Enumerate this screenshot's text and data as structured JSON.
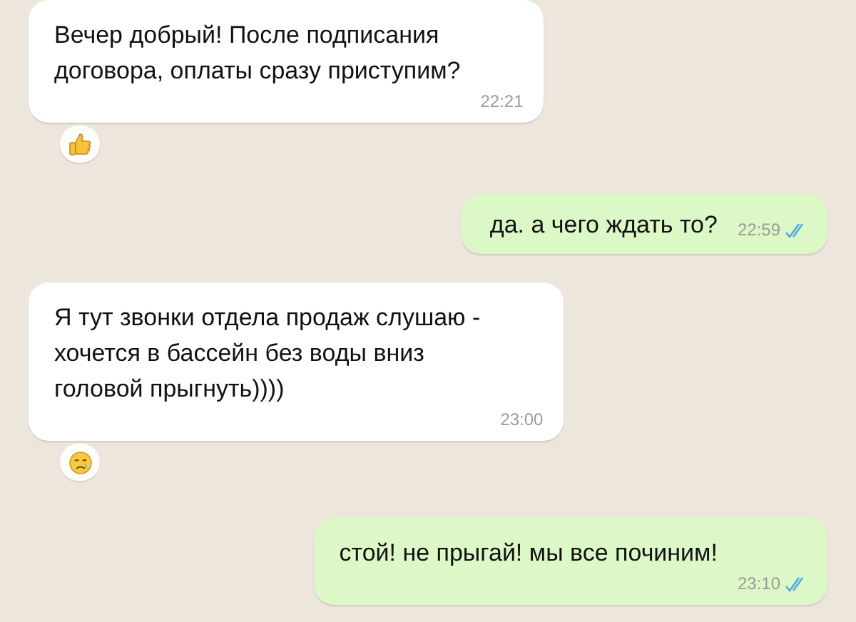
{
  "messages": [
    {
      "kind": "incoming",
      "text": "Вечер добрый! После подписания\nдоговора, оплаты сразу приступим?",
      "time": "22:21",
      "reaction": {
        "kind": "thumbs_up"
      }
    },
    {
      "kind": "outgoing",
      "text": "да. а чего ждать то?",
      "time": "22:59",
      "read": true
    },
    {
      "kind": "incoming",
      "text": "Я тут звонки отдела продаж слушаю -\nхочется в бассейн без воды вниз\nголовой прыгнуть))))",
      "time": "23:00",
      "reaction": {
        "kind": "crying"
      }
    },
    {
      "kind": "outgoing",
      "text": "стой! не прыгай! мы все починим!",
      "time": "23:10",
      "read": true
    }
  ]
}
